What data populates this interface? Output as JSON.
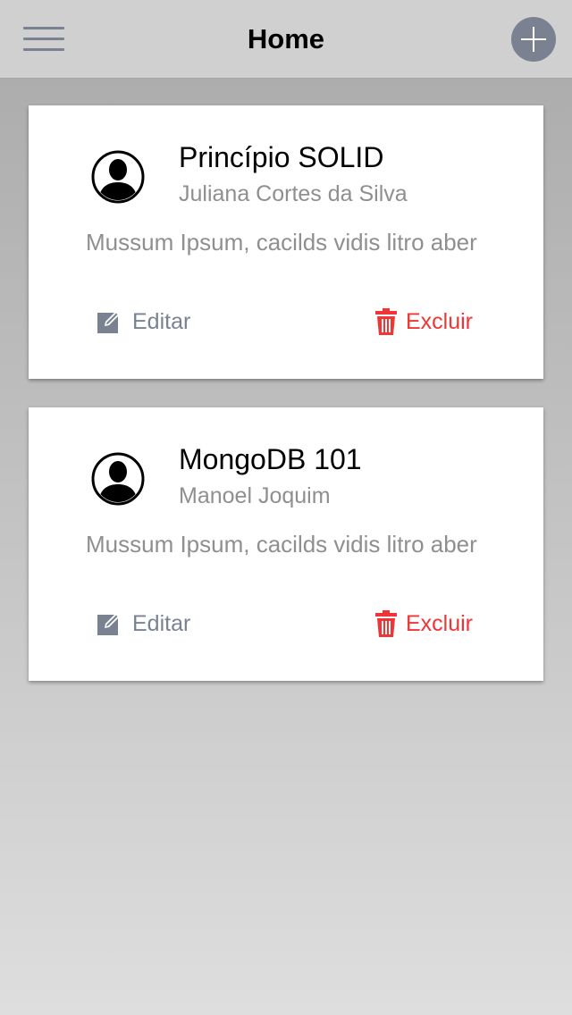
{
  "navbar": {
    "title": "Home",
    "menu_icon": "hamburger-menu-icon",
    "add_icon": "plus-circle-icon",
    "accent_color": "#7a8291"
  },
  "cards": [
    {
      "title": "Princípio SOLID",
      "author": "Juliana Cortes da Silva",
      "description": "Mussum Ipsum, cacilds vidis litro aber",
      "avatar_icon": "user-avatar-icon",
      "edit_label": "Editar",
      "edit_icon": "pencil-square-icon",
      "delete_label": "Excluir",
      "delete_icon": "trash-icon"
    },
    {
      "title": "MongoDB 101",
      "author": "Manoel Joquim",
      "description": "Mussum Ipsum, cacilds vidis litro aber",
      "avatar_icon": "user-avatar-icon",
      "edit_label": "Editar",
      "edit_icon": "pencil-square-icon",
      "delete_label": "Excluir",
      "delete_icon": "trash-icon"
    }
  ],
  "colors": {
    "edit": "#7a8291",
    "delete": "#ef3535"
  }
}
